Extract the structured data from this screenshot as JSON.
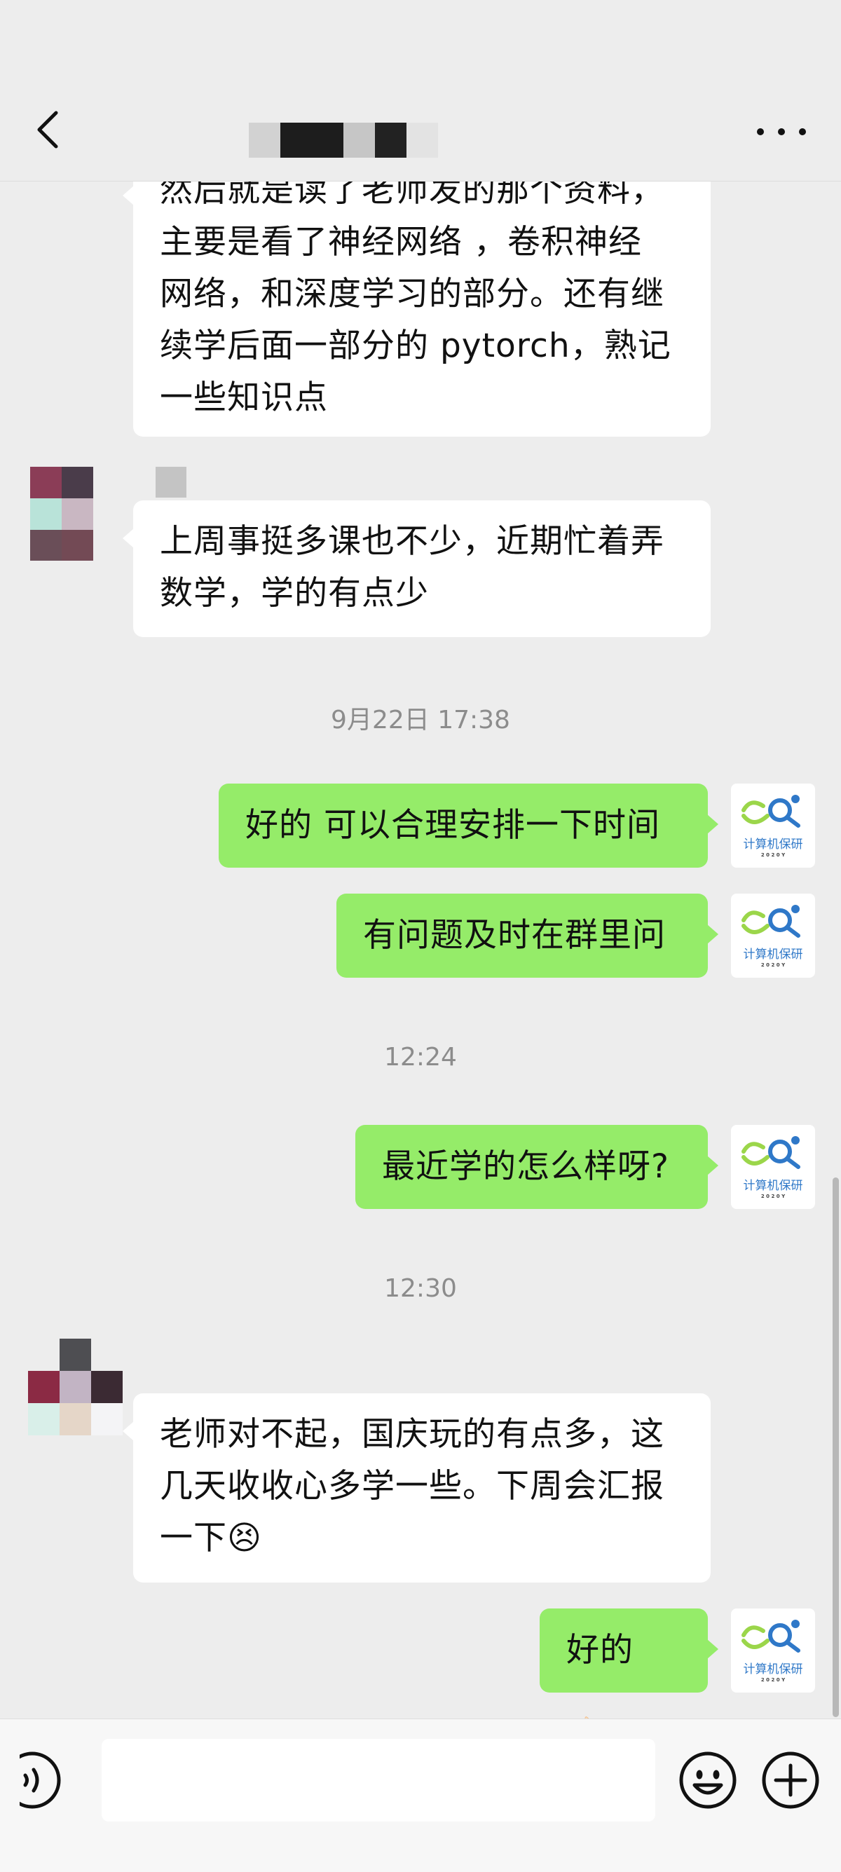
{
  "header": {
    "title": "",
    "back_icon": "chevron-left-icon",
    "more_icon": "more-dots-icon"
  },
  "messages": [
    {
      "side": "in",
      "lines": [
        "然后就是读了老师发的那个资料，",
        "主要是看了神经网络 ，卷积神经",
        "网络，和深度学习的部分。还有继",
        "续学后面一部分的 pytorch，熟记",
        "一些知识点"
      ]
    },
    {
      "side": "in",
      "lines": [
        "上周事挺多课也不少，近期忙着弄",
        "数学，学的有点少"
      ]
    },
    {
      "timestamp": "9月22日 17:38"
    },
    {
      "side": "out",
      "text": "好的 可以合理安排一下时间"
    },
    {
      "side": "out",
      "text": "有问题及时在群里问"
    },
    {
      "timestamp": "12:24"
    },
    {
      "side": "out",
      "text": "最近学的怎么样呀?"
    },
    {
      "timestamp": "12:30"
    },
    {
      "side": "in",
      "lines": [
        "老师对不起，国庆玩的有点多，这",
        "几天收收心多学一些。下周会汇报",
        "一下"
      ],
      "emoji": "😣"
    },
    {
      "side": "out",
      "text": "好的",
      "emoji": "👌🏻"
    }
  ],
  "my_avatar": {
    "caption": "计算机保研",
    "subcaption": "2 0 2 0 Y"
  },
  "input_bar": {
    "placeholder": "",
    "voice_icon": "voice-icon",
    "emoji_icon": "emoji-icon",
    "plus_icon": "plus-icon"
  },
  "colors": {
    "background": "#ededed",
    "bubble_incoming": "#ffffff",
    "bubble_outgoing": "#95ec69",
    "timestamp_text": "#8c8c8c",
    "avatar_caption": "#2f78c8"
  }
}
